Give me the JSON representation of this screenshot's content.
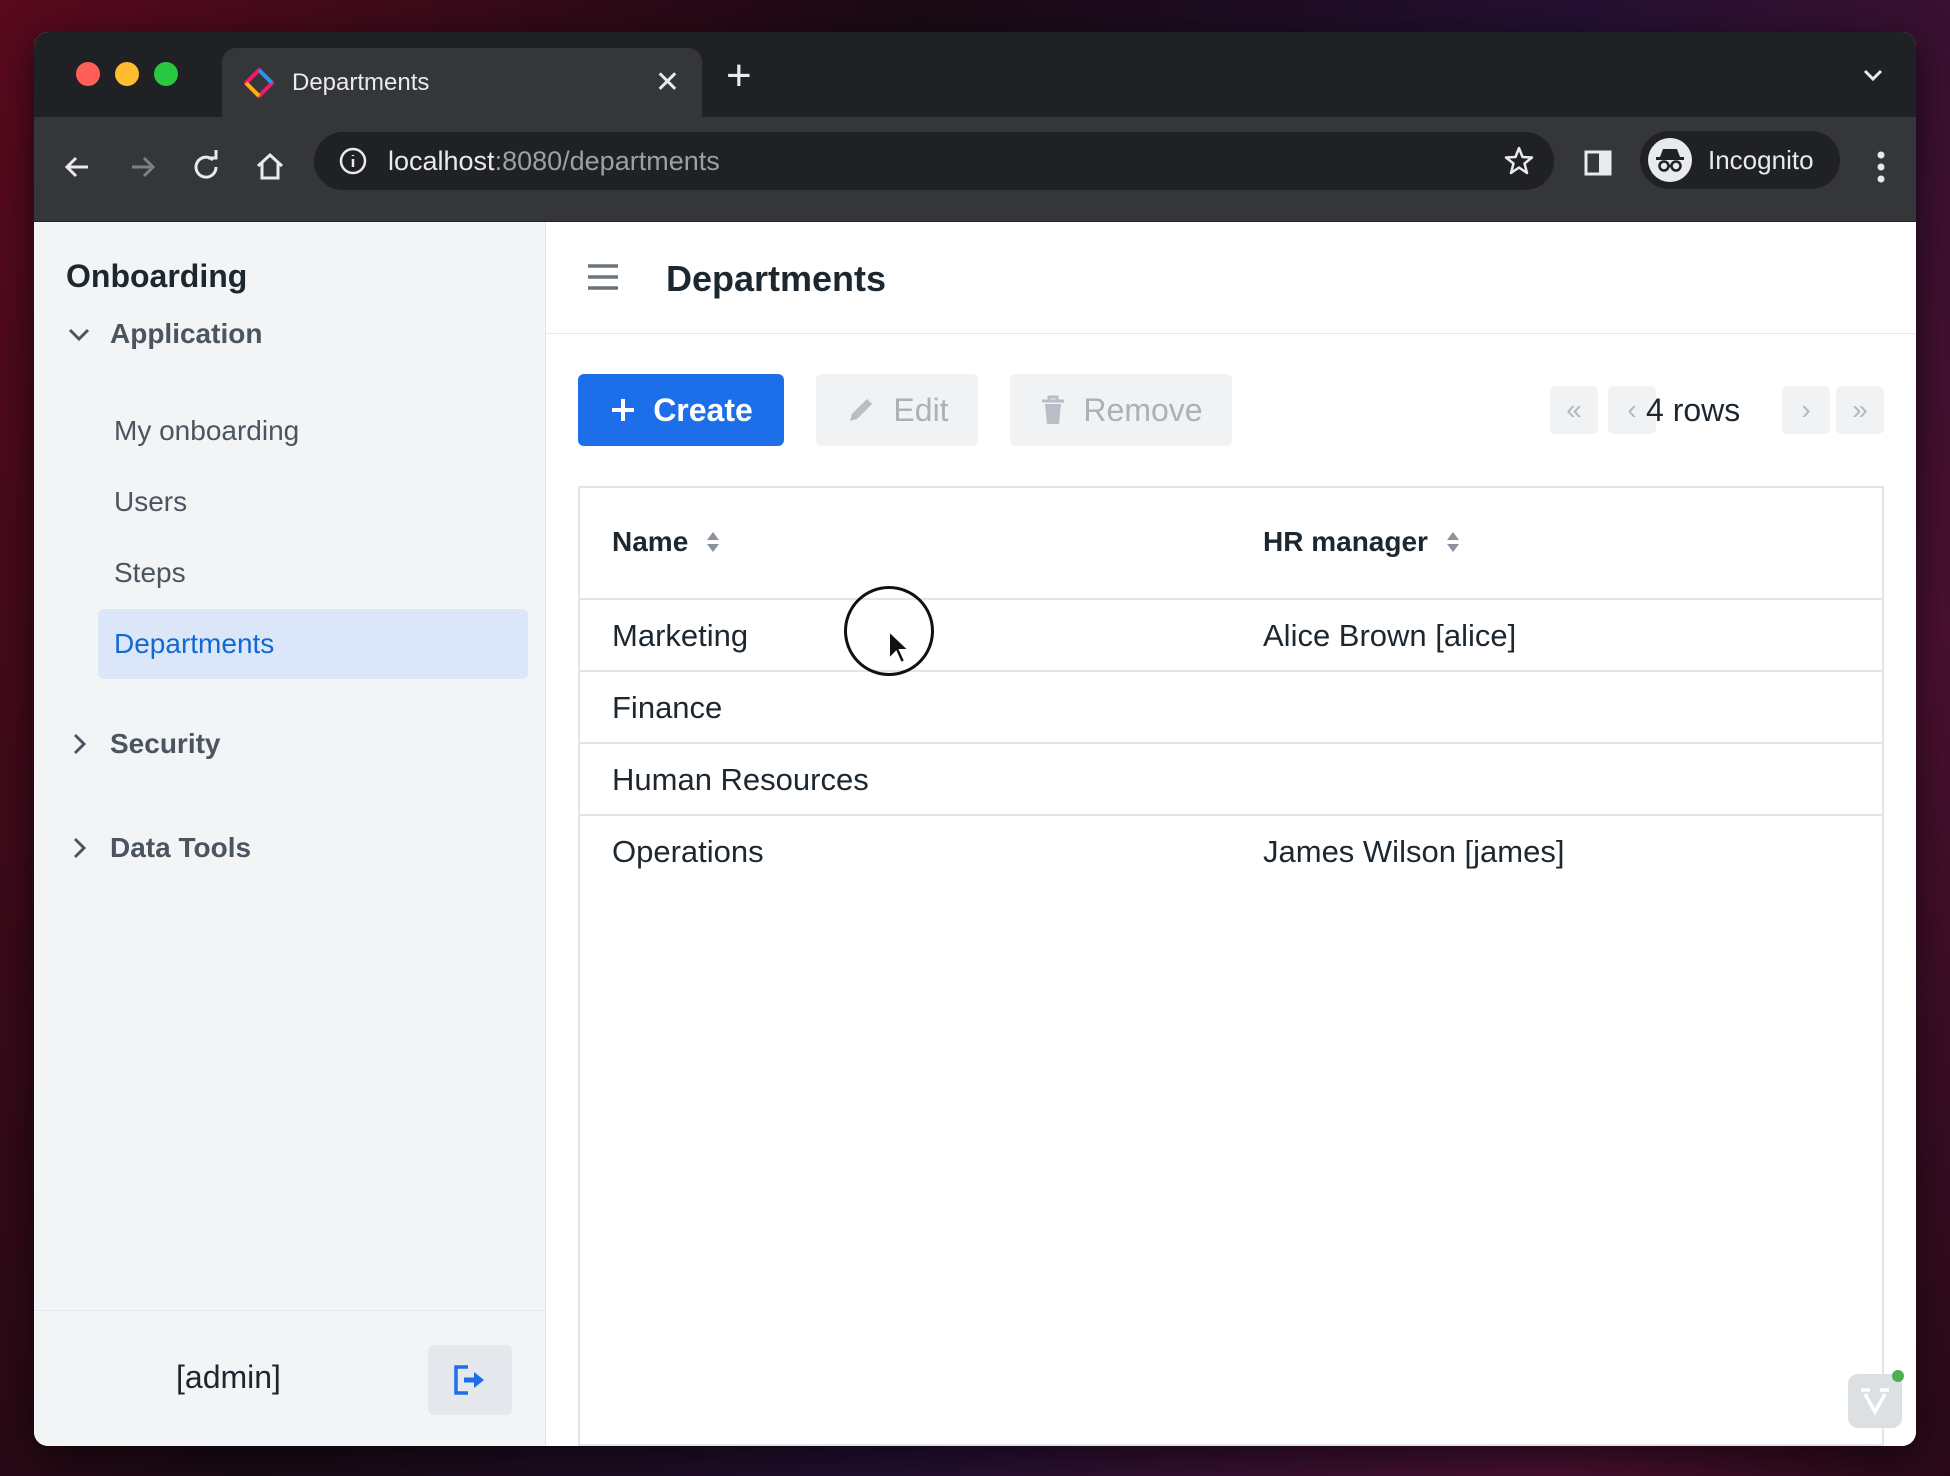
{
  "browser": {
    "tab_title": "Departments",
    "url_host": "localhost",
    "url_rest": ":8080/departments",
    "profile_label": "Incognito"
  },
  "sidebar": {
    "app_title": "Onboarding",
    "groups": [
      {
        "label": "Application",
        "expanded": true
      },
      {
        "label": "Security",
        "expanded": false
      },
      {
        "label": "Data Tools",
        "expanded": false
      }
    ],
    "items": [
      {
        "label": "My onboarding",
        "active": false
      },
      {
        "label": "Users",
        "active": false
      },
      {
        "label": "Steps",
        "active": false
      },
      {
        "label": "Departments",
        "active": true
      }
    ],
    "user_label": "[admin]"
  },
  "header": {
    "title": "Departments"
  },
  "toolbar": {
    "create_label": "Create",
    "edit_label": "Edit",
    "remove_label": "Remove",
    "rows_label": "4 rows"
  },
  "grid": {
    "columns": [
      "Name",
      "HR manager"
    ],
    "rows": [
      {
        "name": "Marketing",
        "hr_manager": "Alice Brown [alice]"
      },
      {
        "name": "Finance",
        "hr_manager": ""
      },
      {
        "name": "Human Resources",
        "hr_manager": ""
      },
      {
        "name": "Operations",
        "hr_manager": "James Wilson [james]"
      }
    ]
  },
  "colors": {
    "accent": "#1c6fe8",
    "active_nav_bg": "#dbe7f8",
    "active_nav_text": "#1269d3"
  },
  "icons": [
    "back-arrow-icon",
    "forward-arrow-icon",
    "reload-icon",
    "home-icon",
    "info-icon",
    "star-icon",
    "side-panel-icon",
    "incognito-icon",
    "kebab-menu-icon",
    "hamburger-icon",
    "plus-icon",
    "pencil-icon",
    "trash-icon",
    "sort-icon",
    "logout-icon",
    "chevron-down-icon",
    "chevron-right-icon"
  ]
}
